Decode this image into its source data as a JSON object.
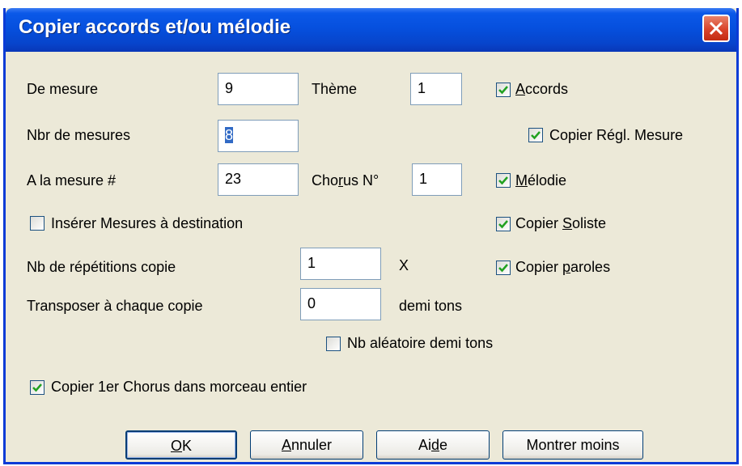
{
  "window": {
    "title": "Copier accords et/ou mélodie"
  },
  "fields": {
    "de_mesure": {
      "label": "De mesure",
      "value": "9"
    },
    "theme": {
      "label": "Thème",
      "value": "1"
    },
    "nbr_mesures": {
      "label": "Nbr de mesures",
      "value": "8"
    },
    "a_la_mesure": {
      "label": "A la mesure #",
      "value": "23"
    },
    "chorus_no": {
      "label_pre": "Cho",
      "label_u": "r",
      "label_post": "us N°",
      "value": "1"
    },
    "repetitions": {
      "label": "Nb de répétitions copie",
      "value": "1",
      "suffix": "X"
    },
    "transposer": {
      "label": "Transposer à chaque copie",
      "value": "0",
      "suffix": "demi tons"
    }
  },
  "checkboxes": {
    "accords": {
      "pre": "",
      "u": "A",
      "post": "ccords",
      "checked": true
    },
    "copier_regl": {
      "label": "Copier Régl. Mesure",
      "checked": true
    },
    "melodie": {
      "pre": "",
      "u": "M",
      "post": "élodie",
      "checked": true
    },
    "copier_soliste": {
      "pre": "Copier ",
      "u": "S",
      "post": "oliste",
      "checked": true
    },
    "copier_paroles": {
      "pre": "Copier ",
      "u": "p",
      "post": "aroles",
      "checked": true
    },
    "inserer": {
      "label": "Insérer Mesures à destination",
      "checked": false
    },
    "aleatoire": {
      "label": "Nb aléatoire demi tons",
      "checked": false
    },
    "copier_chorus": {
      "label": "Copier 1er Chorus dans morceau entier",
      "checked": true
    }
  },
  "buttons": {
    "ok": {
      "u": "O",
      "post": "K"
    },
    "annuler": {
      "u": "A",
      "post": "nnuler"
    },
    "aide": {
      "pre": "Ai",
      "u": "d",
      "post": "e"
    },
    "montrer": {
      "label": "Montrer moins"
    }
  }
}
